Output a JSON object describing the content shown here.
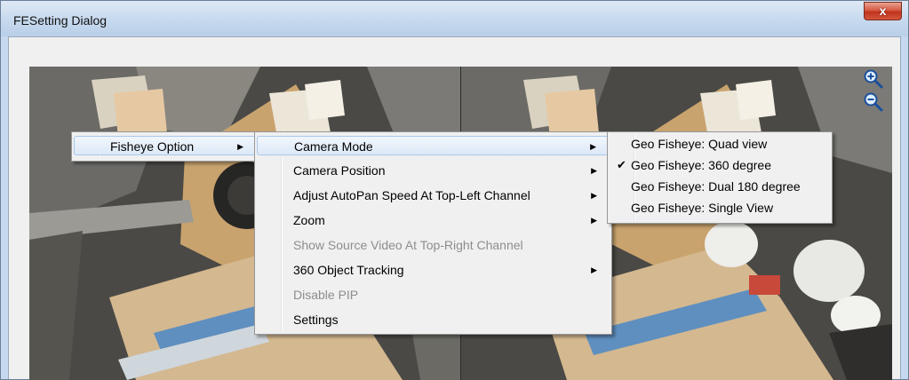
{
  "window": {
    "title": "FESetting Dialog",
    "close_label": "x"
  },
  "colors": {
    "menu_bg": "#f0f0f0",
    "highlight": "#dde9f7",
    "disabled_text": "#8d8d8d"
  },
  "zoom": {
    "in_icon": "zoom-in-icon",
    "out_icon": "zoom-out-icon"
  },
  "menu_level1": {
    "items": [
      {
        "label": "Fisheye Option",
        "has_submenu": true,
        "highlighted": true
      }
    ]
  },
  "menu_level2": {
    "items": [
      {
        "label": "Camera Mode",
        "has_submenu": true,
        "highlighted": true
      },
      {
        "label": "Camera Position",
        "has_submenu": true
      },
      {
        "label": "Adjust AutoPan Speed At Top-Left Channel",
        "has_submenu": true
      },
      {
        "label": "Zoom",
        "has_submenu": true
      },
      {
        "label": "Show Source Video At Top-Right Channel",
        "disabled": true
      },
      {
        "label": "360 Object Tracking",
        "has_submenu": true
      },
      {
        "label": "Disable PIP",
        "disabled": true
      },
      {
        "label": "Settings"
      }
    ]
  },
  "menu_level3": {
    "items": [
      {
        "label": "Geo Fisheye: Quad view"
      },
      {
        "label": "Geo Fisheye: 360 degree",
        "checked": true,
        "check_glyph": "✔"
      },
      {
        "label": "Geo Fisheye: Dual 180 degree"
      },
      {
        "label": "Geo Fisheye: Single View"
      }
    ]
  }
}
